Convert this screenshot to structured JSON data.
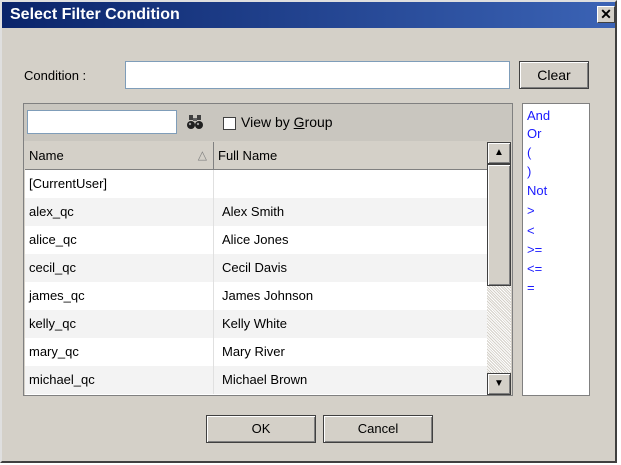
{
  "dialog": {
    "title": "Select Filter Condition",
    "close_label": "✕"
  },
  "condition": {
    "label": "Condition :",
    "value": "",
    "clear_label": "Clear"
  },
  "user_list": {
    "search_value": "",
    "view_by_group_prefix": "View by ",
    "view_by_group_underlined": "G",
    "view_by_group_suffix": "roup",
    "view_by_group_checked": false,
    "columns": [
      "Name",
      "Full Name"
    ],
    "sort_indicator": "△",
    "rows": [
      {
        "name": "[CurrentUser]",
        "full_name": ""
      },
      {
        "name": "alex_qc",
        "full_name": "Alex Smith"
      },
      {
        "name": "alice_qc",
        "full_name": "Alice Jones"
      },
      {
        "name": "cecil_qc",
        "full_name": "Cecil Davis"
      },
      {
        "name": "james_qc",
        "full_name": "James Johnson"
      },
      {
        "name": "kelly_qc",
        "full_name": "Kelly White"
      },
      {
        "name": "mary_qc",
        "full_name": "Mary River"
      },
      {
        "name": "michael_qc",
        "full_name": "Michael Brown"
      }
    ]
  },
  "operators": [
    "And",
    "Or",
    "(",
    ")",
    "Not",
    ">",
    "<",
    ">=",
    "<=",
    "="
  ],
  "buttons": {
    "ok": "OK",
    "cancel": "Cancel"
  },
  "colors": {
    "title_bar": "#0a246a",
    "operator_text": "#1a1aff",
    "dialog_bg": "#d4d0c8"
  },
  "icons": {
    "search": "binoculars-icon",
    "scroll_up": "arrow-up-icon",
    "scroll_down": "arrow-down-icon"
  }
}
